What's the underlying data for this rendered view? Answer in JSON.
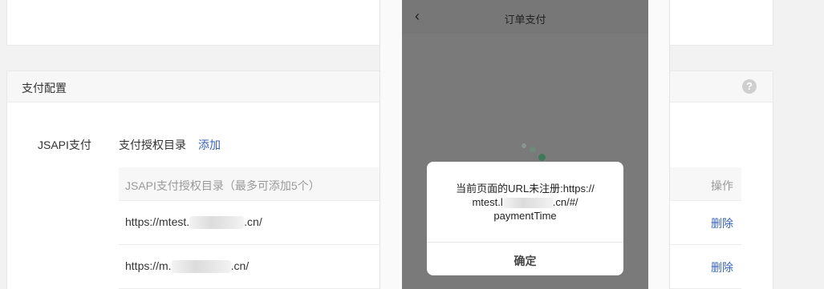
{
  "config": {
    "title": "支付配置",
    "help_icon": "?",
    "jsapi_label": "JSAPI支付",
    "auth_dir_label": "支付授权目录",
    "add_link": "添加",
    "table": {
      "header_dir": "JSAPI支付授权目录（最多可添加5个）",
      "header_action": "操作",
      "rows": [
        {
          "url_prefix": "https://mtest.",
          "url_suffix": ".cn/",
          "action": "删除"
        },
        {
          "url_prefix": "https://m.",
          "url_suffix": ".cn/",
          "action": "删除"
        }
      ]
    }
  },
  "phone": {
    "back_icon": "chevron-left-icon",
    "title": "订单支付",
    "dialog": {
      "message_line1": "当前页面的URL未注册:https://",
      "message_line2": "mtest.l",
      "message_line2_end": ".cn/#/",
      "message_line3": "paymentTime",
      "confirm": "确定"
    }
  },
  "colors": {
    "link": "#3a64b8",
    "overlay": "#7a7a7a",
    "header_bg": "#f7f7f7"
  }
}
